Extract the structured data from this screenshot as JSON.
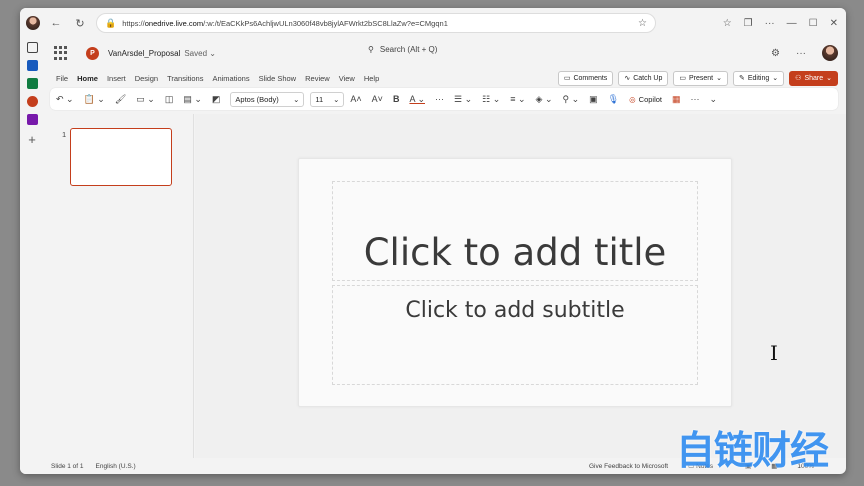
{
  "browser": {
    "url_prefix": "https://",
    "url_host": "onedrive.live.com",
    "url_rest": "/:w:/t/EaCKkPs6AchljwULn3060f48vb8jylAFWrkt2bSC8LlaZw?e=CMgqn1"
  },
  "app": {
    "file_name": "VanArsdel_Proposal",
    "save_status": "Saved",
    "search_placeholder": "Search (Alt + Q)"
  },
  "menu": {
    "tabs": [
      "File",
      "Home",
      "Insert",
      "Design",
      "Transitions",
      "Animations",
      "Slide Show",
      "Review",
      "View",
      "Help"
    ],
    "active_tab": "Home",
    "comments": "Comments",
    "catch_up": "Catch Up",
    "present": "Present",
    "editing": "Editing",
    "share": "Share"
  },
  "ribbon": {
    "font_name": "Aptos (Body)",
    "font_size": "11",
    "copilot": "Copilot"
  },
  "thumbnails": {
    "slide_number": "1"
  },
  "slide": {
    "title_placeholder": "Click to add title",
    "subtitle_placeholder": "Click to add subtitle"
  },
  "status": {
    "slide_info": "Slide 1 of 1",
    "language": "English (U.S.)",
    "feedback": "Give Feedback to Microsoft",
    "notes": "Notes",
    "zoom": "100%"
  },
  "watermark": "自链财经",
  "colors": {
    "accent": "#c43e1c",
    "watermark": "#2f8cf0"
  }
}
